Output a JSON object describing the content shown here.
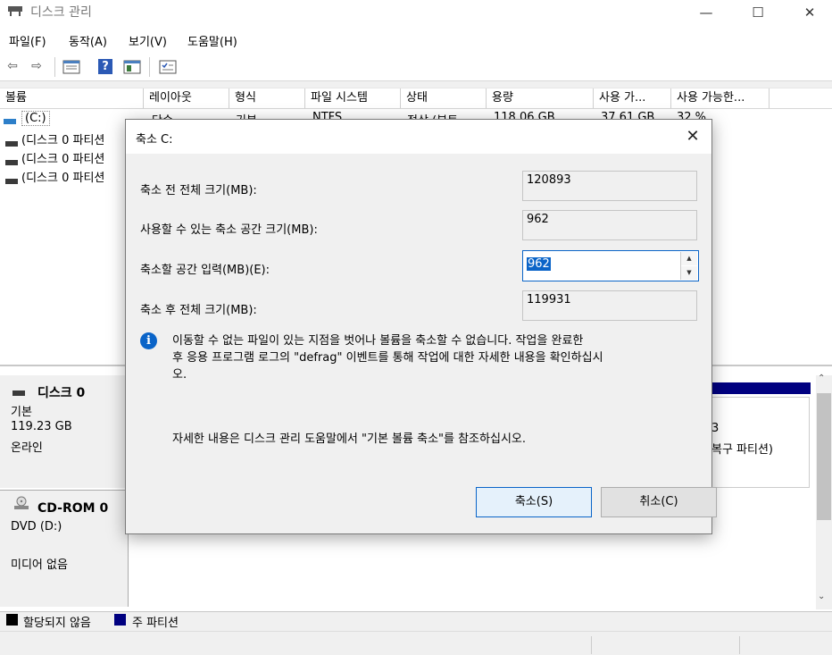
{
  "window": {
    "title": "디스크 관리",
    "minimize": "—",
    "maximize": "☐",
    "close": "✕"
  },
  "menu": [
    "파일(F)",
    "동작(A)",
    "보기(V)",
    "도움말(H)"
  ],
  "toolbar": {
    "back": "⇦",
    "forward": "⇨",
    "help": "?"
  },
  "list": {
    "headers": [
      "볼륨",
      "레이아웃",
      "형식",
      "파일 시스템",
      "상태",
      "용량",
      "사용 가...",
      "사용 가능한..."
    ],
    "first_row": {
      "volume": "(C:)",
      "layout": "단순",
      "type": "기본",
      "fs": "NTFS",
      "status": "정상 (부트...",
      "capacity": "118.06 GB",
      "free": "37.61 GB",
      "pct": "32 %"
    },
    "rows": [
      "(디스크 0 파티션",
      "(디스크 0 파티션",
      "(디스크 0 파티션"
    ]
  },
  "disk0": {
    "name": "디스크 0",
    "type": "기본",
    "size": "119.23 GB",
    "status": "온라인",
    "partition_tail": "3",
    "partition_tail2": "복구 파티션)"
  },
  "cdrom": {
    "name": "CD-ROM 0",
    "drive": "DVD (D:)",
    "media": "미디어 없음"
  },
  "legend": {
    "unallocated": "할당되지 않음",
    "primary": "주 파티션",
    "unallocated_color": "#000000",
    "primary_color": "#000080"
  },
  "dialog": {
    "title": "축소 C:",
    "close": "✕",
    "total_before_label": "축소 전 전체 크기(MB):",
    "total_before_value": "120893",
    "available_label": "사용할 수 있는 축소 공간 크기(MB):",
    "available_value": "962",
    "enter_label": "축소할 공간 입력(MB)(E):",
    "enter_value": "962",
    "total_after_label": "축소 후 전체 크기(MB):",
    "total_after_value": "119931",
    "info_line1": "이동할 수 없는 파일이 있는 지점을 벗어나 볼륨을 축소할 수 없습니다. 작업을 완료한",
    "info_line2": "후 응용 프로그램 로그의 \"defrag\" 이벤트를 통해 작업에 대한 자세한 내용을 확인하십시",
    "info_line3": "오.",
    "help": "자세한 내용은 디스크 관리 도움말에서 \"기본 볼륨 축소\"를 참조하십시오.",
    "shrink_button": "축소(S)",
    "cancel_button": "취소(C)"
  }
}
